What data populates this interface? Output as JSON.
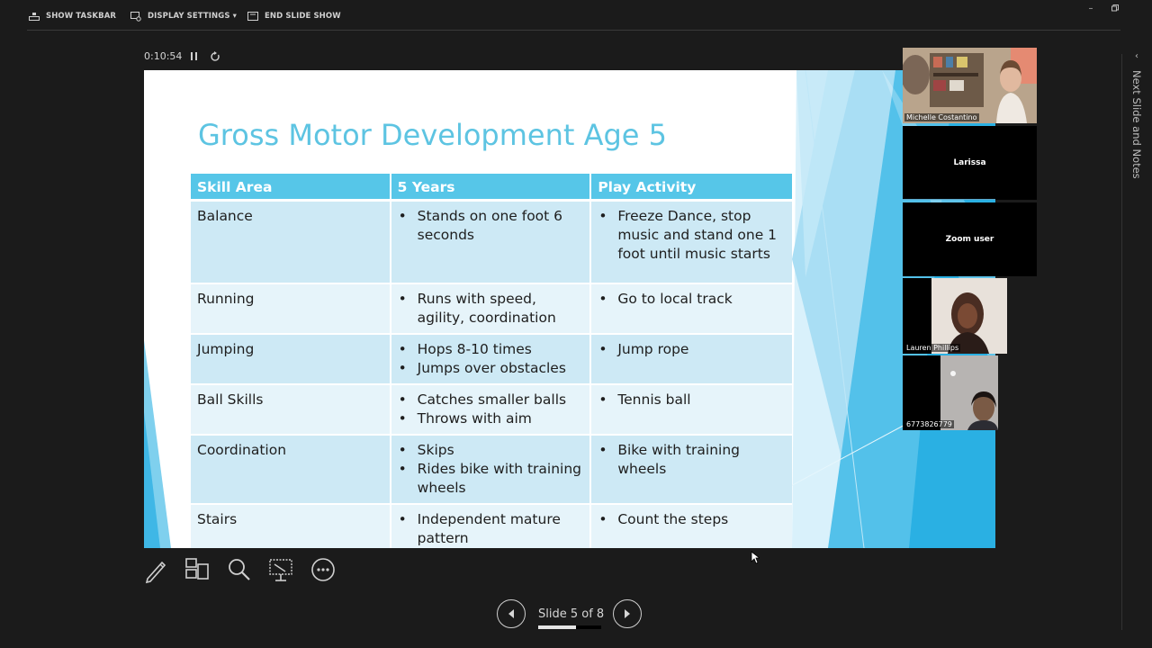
{
  "topbar": {
    "show_taskbar": "SHOW TASKBAR",
    "display_settings": "DISPLAY SETTINGS ▾",
    "end_slide_show": "END SLIDE SHOW"
  },
  "timer": "0:10:54",
  "slide": {
    "title": "Gross Motor Development Age 5",
    "headers": [
      "Skill Area",
      "5 Years",
      "Play Activity"
    ],
    "rows": [
      {
        "skill": "Balance",
        "years": [
          "Stands on one foot 6 seconds"
        ],
        "activity": [
          "Freeze Dance, stop music and stand one 1 foot until music starts"
        ]
      },
      {
        "skill": "Running",
        "years": [
          "Runs with speed, agility, coordination"
        ],
        "activity": [
          "Go to local track"
        ]
      },
      {
        "skill": "Jumping",
        "years": [
          "Hops 8-10 times",
          "Jumps over obstacles"
        ],
        "activity": [
          "Jump rope"
        ]
      },
      {
        "skill": "Ball Skills",
        "years": [
          "Catches smaller balls",
          "Throws with aim"
        ],
        "activity": [
          "Tennis ball"
        ]
      },
      {
        "skill": "Coordination",
        "years": [
          "Skips",
          "Rides bike with training wheels"
        ],
        "activity": [
          "Bike with training wheels"
        ]
      },
      {
        "skill": "Stairs",
        "years": [
          "Independent mature pattern"
        ],
        "activity": [
          "Count the steps"
        ]
      }
    ]
  },
  "participants": [
    {
      "name": "Michelle Costantino",
      "type": "video"
    },
    {
      "name": "Larissa",
      "type": "name-only"
    },
    {
      "name": "Zoom user",
      "type": "name-only"
    },
    {
      "name": "Lauren Phillips",
      "type": "video"
    },
    {
      "name": "6773826779",
      "type": "video"
    }
  ],
  "side_panel": {
    "label": "Next Slide and Notes"
  },
  "tools": [
    "pen-icon",
    "slides-grid-icon",
    "zoom-magnifier-icon",
    "presenter-view-icon",
    "more-options-icon"
  ],
  "nav": {
    "counter": "Slide 5 of 8",
    "current": 5,
    "total": 8,
    "progress": 0.6
  },
  "colors": {
    "title": "#5dc4e2",
    "table_header": "#56c6e8",
    "row_dark": "#cde9f5",
    "row_light": "#e6f4fa",
    "accent_blue": "#29b2e4"
  }
}
